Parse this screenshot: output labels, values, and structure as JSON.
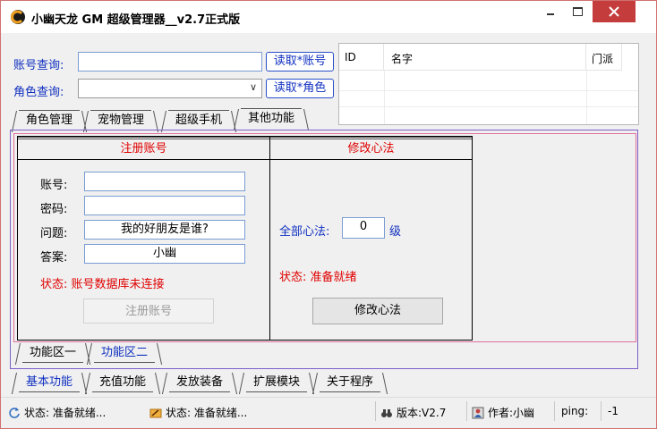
{
  "window": {
    "title": "小幽天龙 GM 超级管理器__v2.7正式版",
    "accent": "#c43c3c"
  },
  "query": {
    "account_label": "账号查询:",
    "account_value": "",
    "role_label": "角色查询:",
    "role_value": "",
    "read_account_button": "读取*账号",
    "read_role_button": "读取*角色"
  },
  "list": {
    "columns": [
      "ID",
      "名字",
      "门派"
    ]
  },
  "top_tabs": [
    "角色管理",
    "宠物管理",
    "超级手机",
    "其他功能"
  ],
  "register": {
    "title": "注册账号",
    "account_label": "账号:",
    "account_value": "",
    "password_label": "密码:",
    "password_value": "",
    "question_label": "问题:",
    "question_value": "我的好朋友是谁?",
    "answer_label": "答案:",
    "answer_value": "小幽",
    "status": "状态: 账号数据库未连接",
    "button": "注册账号"
  },
  "xinfa": {
    "title": "修改心法",
    "all_label": "全部心法:",
    "level_value": "0",
    "level_unit": "级",
    "status": "状态: 准备就绪",
    "button": "修改心法"
  },
  "sub_tabs": [
    "功能区一",
    "功能区二"
  ],
  "bottom_tabs": [
    "基本功能",
    "充值功能",
    "发放装备",
    "扩展模块",
    "关于程序"
  ],
  "statusbar": {
    "status1": "状态: 准备就绪...",
    "status2": "状态: 准备就绪...",
    "version": "版本:V2.7",
    "author": "作者:小幽",
    "ping_label": "ping:",
    "ping_value": "-1"
  },
  "colors": {
    "label_blue": "#1030c0",
    "status_red": "#e00000",
    "tab_frame_purple": "#7a5fc8",
    "tab_frame_pink": "#e0709a"
  },
  "icons": {
    "app": "app-logo-icon",
    "status1": "refresh-icon",
    "status2": "pencil-icon",
    "version": "binoculars-icon",
    "author": "user-card-icon"
  }
}
